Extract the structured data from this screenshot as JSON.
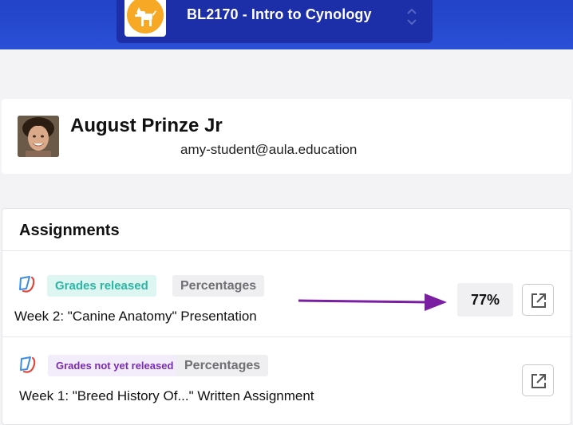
{
  "header": {
    "course_title": "BL2170 - Intro to Cynology",
    "brand_color": "#2a4fd6",
    "logo_icon": "dog-icon",
    "logo_color": "#f7a825"
  },
  "profile": {
    "name": "August Prinze Jr",
    "email": "amy-student@aula.education",
    "avatar_icon": "profile-photo"
  },
  "assignments": {
    "heading": "Assignments",
    "items": [
      {
        "status_badge": "Grades released",
        "grading_scheme": "Percentages",
        "title": "Week 2: \"Canine Anatomy\" Presentation",
        "grade": "77%",
        "icon": "assignment-icon",
        "action_icon": "open-external-icon"
      },
      {
        "status_badge": "Grades not yet released",
        "grading_scheme": "Percentages",
        "title": "Week 1: \"Breed History Of...\" Written Assignment",
        "icon": "assignment-icon",
        "action_icon": "open-external-icon"
      }
    ]
  },
  "colors": {
    "released_badge_text": "#2bb6a3",
    "unreleased_badge_text": "#7a2bb3",
    "annotation_arrow": "#7b1fa2"
  }
}
